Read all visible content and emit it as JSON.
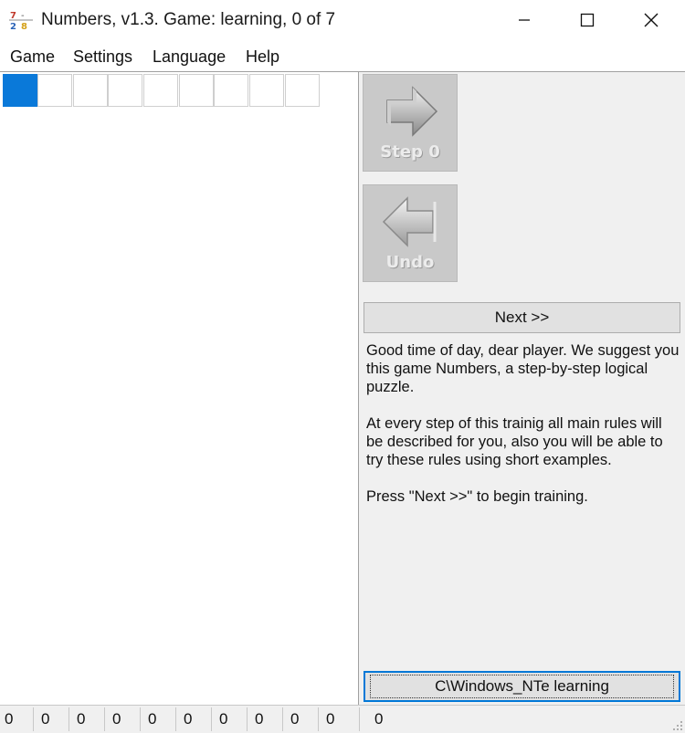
{
  "window": {
    "title": "Numbers, v1.3. Game: learning, 0 of 7"
  },
  "menu": {
    "items": [
      "Game",
      "Settings",
      "Language",
      "Help"
    ]
  },
  "board": {
    "cell_count": 9,
    "selected_index": 0,
    "selection_color": "#0a79d9"
  },
  "panel": {
    "step_label": "Step 0",
    "undo_label": "Undo",
    "next_label": "Next >>",
    "info_paragraphs": [
      "Good time of day, dear player. We suggest you this game Numbers, a step-by-step logical puzzle.",
      "At every step of this trainig all main rules will be described for you, also you will be able to try these rules using short examples.",
      "Press \"Next >>\" to begin training."
    ],
    "learning_button_label": "C\\Windows_NTe learning"
  },
  "status": {
    "counts": [
      "0",
      "0",
      "0",
      "0",
      "0",
      "0",
      "0",
      "0",
      "0",
      "0"
    ],
    "total": "0"
  },
  "icons": {
    "app": "numbers-app-icon",
    "step": "arrow-right-icon",
    "undo": "arrow-left-icon"
  }
}
